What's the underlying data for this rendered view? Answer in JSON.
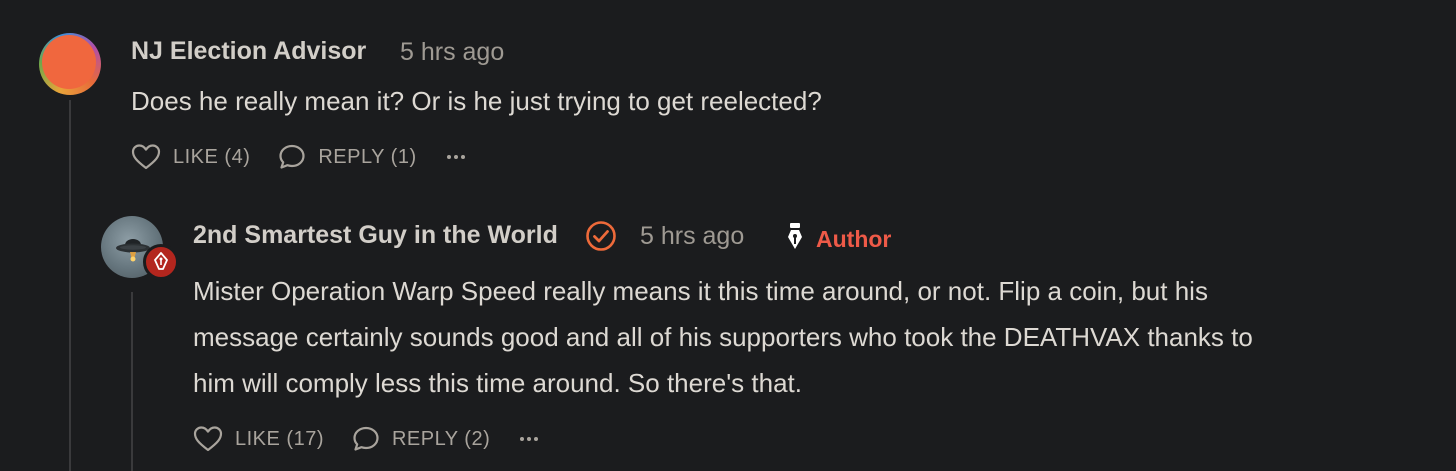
{
  "comments": [
    {
      "author": "NJ Election Advisor",
      "time": "5 hrs ago",
      "body": [
        "Does he really mean it? Or is he just trying to get reelected?"
      ],
      "like_label": "LIKE (4)",
      "reply_label": "REPLY (1)"
    },
    {
      "author": "2nd Smartest Guy in the World",
      "time": "5 hrs ago",
      "badge": "Author",
      "body": [
        "Mister Operation Warp Speed really means it this time around, or not. Flip a coin, but his",
        "message certainly sounds good and all of his supporters who took the DEATHVAX thanks to",
        "him will comply less this time around. So there's that."
      ],
      "like_label": "LIKE (17)",
      "reply_label": "REPLY (2)"
    }
  ],
  "icons": {
    "like": "heart-icon",
    "reply": "speech-bubble-icon",
    "more": "ellipsis-icon",
    "verified": "check-circle-icon",
    "author": "fountain-pen-icon"
  },
  "colors": {
    "background": "#1b1c1e",
    "accent": "#ee5a48",
    "author_badge": "#b3261e"
  }
}
